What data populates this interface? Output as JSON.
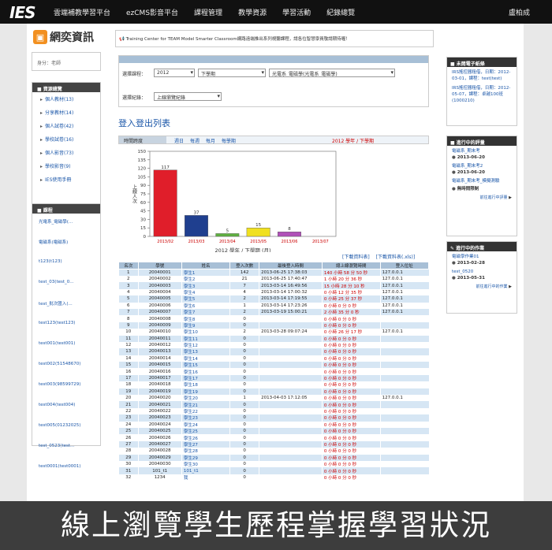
{
  "topbar": {
    "logo": "IES",
    "nav": [
      "雲端補教學習平台",
      "ezCMS影音平台",
      "課程管理",
      "教學資源",
      "學習活動",
      "紀錄總覽"
    ],
    "user": "盧柏成"
  },
  "brand": {
    "title": "網奕資訊"
  },
  "notice": "Training Center for TEAM Model Smarter Classroom網路遠端推出系列視聽課程，請各位智慧學員敬請期待喔！",
  "identity": "身分：老師",
  "resources": {
    "title": "資源總覽",
    "items": [
      "個人教材(13)",
      "分享教材(14)",
      "個人試卷(42)",
      "學校試卷(16)",
      "個人影音(73)",
      "學校影音(9)",
      "IES使用手冊"
    ]
  },
  "courses": {
    "title": "課程",
    "items": [
      "光電系_電磁學(...",
      "電磁系(電磁系)",
      "t123(t123)",
      "test_03(test_0...",
      "test_批次匯入(...",
      "test123(test123)",
      "test001(test001)",
      "test002(51548670)",
      "test003(98599729)",
      "test004(test004)",
      "test005(01232025)",
      "test_0523(test...",
      "test0001(test0001)"
    ]
  },
  "filter": {
    "course_label": "選擇課程：",
    "year": "2012",
    "semester": "下學期",
    "course": "光電系_電磁學(光電系_電磁學)",
    "record_label": "選擇紀錄：",
    "record": "上線瀏覽紀錄"
  },
  "list_title": "登入登出列表",
  "period": {
    "label": "時間跨度",
    "links": [
      "週日",
      "每週",
      "每月",
      "每學期"
    ],
    "semester": "2012 學年 / 下學期"
  },
  "chart_data": {
    "type": "bar",
    "categories": [
      "2013/02",
      "2013/03",
      "2013/04",
      "2013/05",
      "2013/06",
      "2013/07"
    ],
    "values": [
      117,
      37,
      5,
      15,
      8,
      0
    ],
    "colors": [
      "#e01e2a",
      "#1f3f8f",
      "#5fb040",
      "#f0e020",
      "#b050b8",
      "#888888"
    ],
    "value_labels": [
      "117",
      "37",
      "5",
      "15",
      "8",
      ""
    ],
    "yticks": [
      0,
      15,
      30,
      45,
      60,
      75,
      90,
      105,
      120,
      135,
      150
    ],
    "ylim": [
      0,
      150
    ],
    "ylabel": "上線人次",
    "xlabel": "2012 學年 / 下學期 (月)"
  },
  "downloads": [
    "[下載資料表]",
    "[下載資料表(.xls)]"
  ],
  "table": {
    "headers": [
      "名次",
      "學號",
      "姓名",
      "登入次數",
      "最後登入時間",
      "總上線瀏覽時間",
      "登入位址"
    ],
    "rows": [
      [
        "1",
        "20040001",
        "學生1",
        "142",
        "2013-06-25 17:38:03",
        "140 小時 58 分 50 秒",
        "127.0.0.1"
      ],
      [
        "2",
        "20040002",
        "學生2",
        "21",
        "2013-06-25 17:40:47",
        "1 小時 20 分 36 秒",
        "127.0.0.1"
      ],
      [
        "3",
        "20040003",
        "學生3",
        "7",
        "2013-03-14 16:49:56",
        "15 小時 28 分 10 秒",
        "127.0.0.1"
      ],
      [
        "4",
        "20040004",
        "學生4",
        "4",
        "2013-03-14 17:00:32",
        "0 小時 12 分 35 秒",
        "127.0.0.1"
      ],
      [
        "5",
        "20040005",
        "學生5",
        "2",
        "2013-03-14 17:19:55",
        "0 小時 25 分 37 秒",
        "127.0.0.1"
      ],
      [
        "6",
        "20040006",
        "學生6",
        "1",
        "2013-03-14 17:23:26",
        "0 小時 0 分 0 秒",
        "127.0.0.1"
      ],
      [
        "7",
        "20040007",
        "學生7",
        "2",
        "2013-03-19 15:00:21",
        "2 小時 35 分 0 秒",
        "127.0.0.1"
      ],
      [
        "8",
        "20040008",
        "學生8",
        "0",
        "",
        "0 小時 0 分 0 秒",
        ""
      ],
      [
        "9",
        "20040009",
        "學生9",
        "0",
        "",
        "0 小時 0 分 0 秒",
        ""
      ],
      [
        "10",
        "20040010",
        "學生10",
        "2",
        "2013-03-28 09:07:24",
        "0 小時 26 分 17 秒",
        "127.0.0.1"
      ],
      [
        "11",
        "20040011",
        "學生11",
        "0",
        "",
        "0 小時 0 分 0 秒",
        ""
      ],
      [
        "12",
        "20040012",
        "學生12",
        "0",
        "",
        "0 小時 0 分 0 秒",
        ""
      ],
      [
        "13",
        "20040013",
        "學生13",
        "0",
        "",
        "0 小時 0 分 0 秒",
        ""
      ],
      [
        "14",
        "20040014",
        "學生14",
        "0",
        "",
        "0 小時 0 分 0 秒",
        ""
      ],
      [
        "15",
        "20040015",
        "學生15",
        "0",
        "",
        "0 小時 0 分 0 秒",
        ""
      ],
      [
        "16",
        "20040016",
        "學生16",
        "0",
        "",
        "0 小時 0 分 0 秒",
        ""
      ],
      [
        "17",
        "20040017",
        "學生17",
        "0",
        "",
        "0 小時 0 分 0 秒",
        ""
      ],
      [
        "18",
        "20040018",
        "學生18",
        "0",
        "",
        "0 小時 0 分 0 秒",
        ""
      ],
      [
        "19",
        "20040019",
        "學生19",
        "0",
        "",
        "0 小時 0 分 0 秒",
        ""
      ],
      [
        "20",
        "20040020",
        "學生20",
        "1",
        "2013-04-03 17:12:05",
        "0 小時 0 分 0 秒",
        "127.0.0.1"
      ],
      [
        "21",
        "20040021",
        "學生21",
        "0",
        "",
        "0 小時 0 分 0 秒",
        ""
      ],
      [
        "22",
        "20040022",
        "學生22",
        "0",
        "",
        "0 小時 0 分 0 秒",
        ""
      ],
      [
        "23",
        "20040023",
        "學生23",
        "0",
        "",
        "0 小時 0 分 0 秒",
        ""
      ],
      [
        "24",
        "20040024",
        "學生24",
        "0",
        "",
        "0 小時 0 分 0 秒",
        ""
      ],
      [
        "25",
        "20040025",
        "學生25",
        "0",
        "",
        "0 小時 0 分 0 秒",
        ""
      ],
      [
        "26",
        "20040026",
        "學生26",
        "0",
        "",
        "0 小時 0 分 0 秒",
        ""
      ],
      [
        "27",
        "20040027",
        "學生27",
        "0",
        "",
        "0 小時 0 分 0 秒",
        ""
      ],
      [
        "28",
        "20040028",
        "學生28",
        "0",
        "",
        "0 小時 0 分 0 秒",
        ""
      ],
      [
        "29",
        "20040029",
        "學生29",
        "0",
        "",
        "0 小時 0 分 0 秒",
        ""
      ],
      [
        "30",
        "20040030",
        "學生30",
        "0",
        "",
        "0 小時 0 分 0 秒",
        ""
      ],
      [
        "31",
        "101_t1",
        "101_t1",
        "0",
        "",
        "0 小時 0 分 0 秒",
        ""
      ],
      [
        "32",
        "1234",
        "我",
        "0",
        "",
        "0 小時 0 分 0 秒",
        ""
      ]
    ]
  },
  "right": {
    "news": {
      "title": "未閱電子紙條",
      "items": [
        {
          "link": "IRS搖控器租借，日期：2012-03-01，課程：test(test)"
        },
        {
          "link": "IRS搖控器租借，日期：2012-05-07，課程：卓越100班(1000210)"
        }
      ]
    },
    "evals": {
      "title": "進行中的評量",
      "items": [
        {
          "link": "電磁系_期末考",
          "date": "2013-06-20"
        },
        {
          "link": "電磁系_期末考2",
          "date": "2013-06-20"
        },
        {
          "link": "電磁系_期末考_模擬測驗",
          "date": "無時間限制"
        }
      ],
      "more": "前往進行中評量"
    },
    "homework": {
      "title": "進行中的作業",
      "items": [
        {
          "link": "電磁學作業01",
          "date": "2013-02-28"
        },
        {
          "link": "test_0520",
          "date": "2013-05-31"
        }
      ],
      "more": "前往進行中的作業"
    }
  },
  "caption": "線上瀏覽學生歷程掌握學習狀況"
}
